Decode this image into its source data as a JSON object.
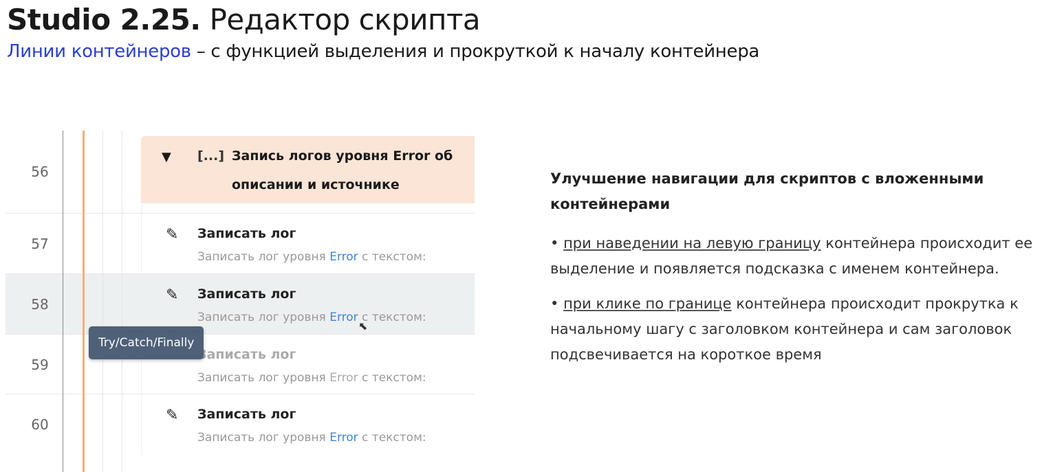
{
  "header": {
    "title_bold": "Studio 2.25.",
    "title_rest": " Редактор скрипта",
    "subtitle_accent": "Линии контейнеров",
    "subtitle_rest": " – с функцией выделения и прокруткой к началу контейнера"
  },
  "editor": {
    "container": {
      "line": "56",
      "bracket": "[...]",
      "title": "Запись логов уровня Error об описании и источнике",
      "expanded": true
    },
    "steps": [
      {
        "line": "57",
        "title": "Записать лог",
        "desc_a": "Записать лог уровня ",
        "desc_err": "Error",
        "desc_b": " с текстом:"
      },
      {
        "line": "58",
        "title": "Записать лог",
        "desc_a": "Записать лог уровня ",
        "desc_err": "Error",
        "desc_b": " с текстом:"
      },
      {
        "line": "59",
        "title": "Записать лог",
        "desc_a": "Записать лог уровня ",
        "desc_err": "Error",
        "desc_b": " с текстом:"
      },
      {
        "line": "60",
        "title": "Записать лог",
        "desc_a": "Записать лог уровня ",
        "desc_err": "Error",
        "desc_b": " с текстом:"
      }
    ],
    "tooltip": "Try/Catch/Finally",
    "colors": {
      "container_line": "#f0b07a",
      "header_bg": "#fbe5d6",
      "tooltip_bg": "#4f6179",
      "error": "#3a86d6"
    }
  },
  "description": {
    "heading": "Улучшение навигации для скриптов с вложенными контейнерами",
    "bullets": [
      {
        "prefix": "• ",
        "underlined": "при наведении на левую границу",
        "rest": " контейнера происходит ее выделение и появляется подсказка с именем контейнера."
      },
      {
        "prefix": " • ",
        "underlined": "при клике по границе",
        "rest": " контейнера происходит прокрутка к начальному шагу с заголовком контейнера и сам заголовок подсвечивается на короткое время"
      }
    ]
  }
}
